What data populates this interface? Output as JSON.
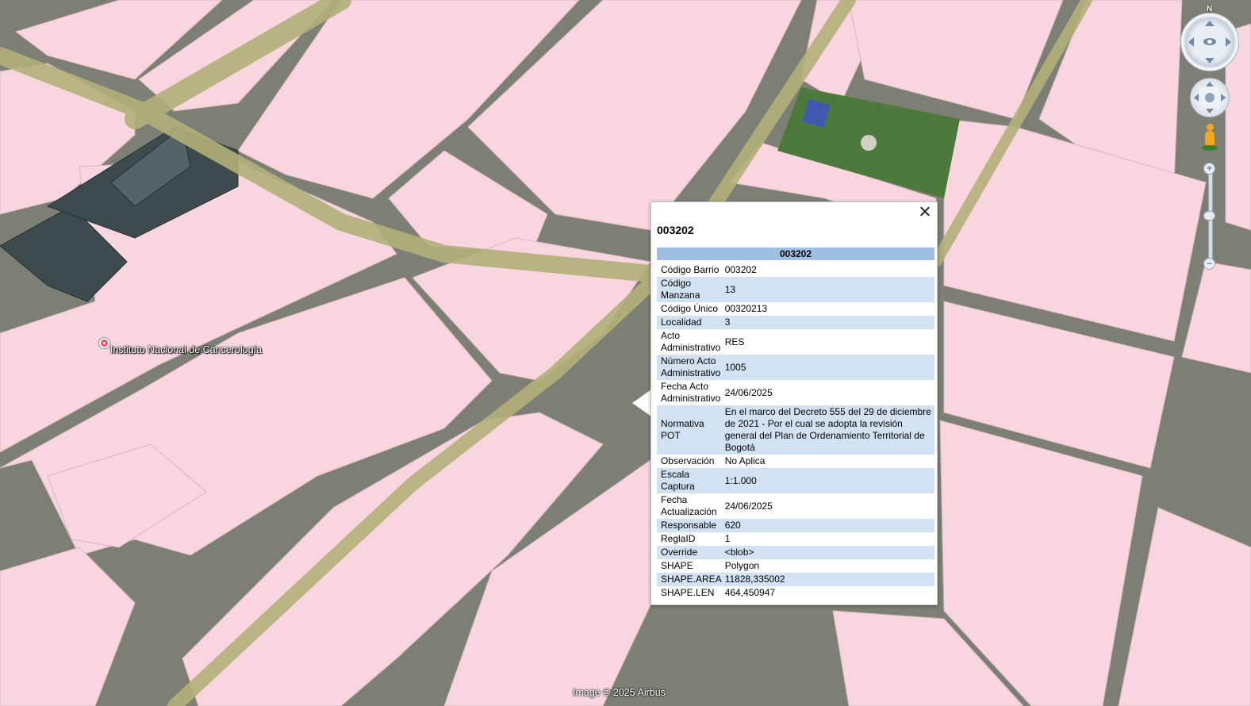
{
  "map": {
    "place_label": "Instituto Nacional de Cancerología",
    "attribution": "Image © 2025 Airbus",
    "compass_label": "N",
    "parcel_fill": "#f9d6df",
    "road_color": "#6b6c66"
  },
  "popup": {
    "title": "003202",
    "table_header": "003202",
    "header_color": "#9fbfe3",
    "alt_row_color": "#d2e2f2",
    "rows": [
      {
        "key": "Código Barrio",
        "value": "003202"
      },
      {
        "key": "Código Manzana",
        "value": "13"
      },
      {
        "key": "Código Único",
        "value": "00320213"
      },
      {
        "key": "Localidad",
        "value": "3"
      },
      {
        "key": "Acto Administrativo",
        "value": "RES"
      },
      {
        "key": "Número Acto Administrativo",
        "value": "1005"
      },
      {
        "key": "Fecha Acto Administrativo",
        "value": "24/06/2025"
      },
      {
        "key": "Normativa POT",
        "value": "En el marco del Decreto 555 del 29 de diciembre de 2021 - Por el cual se adopta la revisión general del Plan de Ordenamiento Territorial de Bogotá"
      },
      {
        "key": "Observación",
        "value": "No Aplica"
      },
      {
        "key": "Escala Captura",
        "value": "1:1.000"
      },
      {
        "key": "Fecha Actualización",
        "value": "24/06/2025"
      },
      {
        "key": "Responsable",
        "value": "620"
      },
      {
        "key": "ReglaID",
        "value": "1"
      },
      {
        "key": "Override",
        "value": "<blob>"
      },
      {
        "key": "SHAPE",
        "value": "Polygon"
      },
      {
        "key": "SHAPE.AREA",
        "value": "11828,335002"
      },
      {
        "key": "SHAPE.LEN",
        "value": "464,450947"
      }
    ]
  },
  "controls": {
    "zoom_in": "+",
    "zoom_out": "−",
    "icons": [
      "look-around-icon",
      "move-icon",
      "pegman-icon",
      "zoom-slider"
    ]
  }
}
